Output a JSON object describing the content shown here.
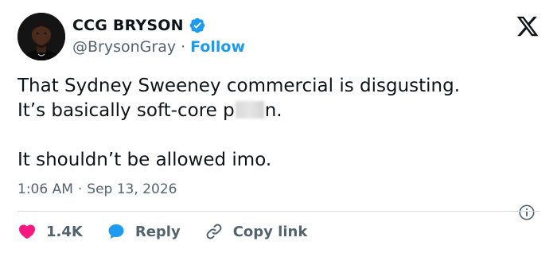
{
  "user": {
    "display_name": "CCG BRYSON",
    "handle": "@BrysonGray",
    "separator": "·",
    "follow_label": "Follow",
    "avatar_icon": "avatar-photo"
  },
  "tweet": {
    "line1": "That Sydney Sweeney commercial is disgusting.",
    "line2_before": "It’s basically soft-core p",
    "line2_after": "n.",
    "line3": "It shouldn’t be allowed imo."
  },
  "meta": {
    "time": "1:06 AM",
    "separator": "·",
    "date": "Sep 13, 2026"
  },
  "actions": {
    "like_count": "1.4K",
    "reply_label": "Reply",
    "copy_label": "Copy link"
  },
  "colors": {
    "accent": "#1d9bf0",
    "like": "#f91880",
    "text": "#0f1419",
    "muted": "#536471"
  }
}
